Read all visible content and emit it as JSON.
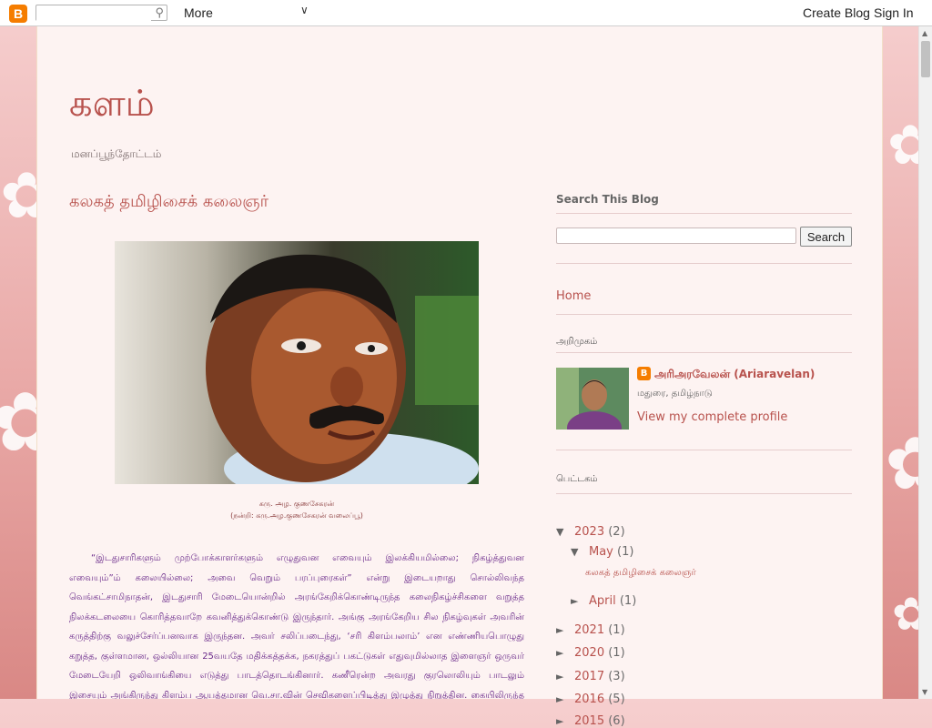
{
  "navbar": {
    "logo_glyph": "B",
    "search_placeholder": "",
    "more_label": "More",
    "create_blog": "Create Blog",
    "sign_in": "Sign In"
  },
  "blog": {
    "title": "களம்",
    "description": "மனப்பூந்தோட்டம்"
  },
  "post": {
    "title": "கலகத் தமிழிசைக் கலைஞர்",
    "caption_name": "கரு. அழ. குணசேகரன்",
    "caption_credit": "(நன்றி: கரு.அழ.குணசேகரன் வலைப்பூ)",
    "body": "“இடதுசாரிகளும் முற்போக்காளர்களும் எழுதுவன எவையும் இலக்கியமில்லை; நிகழ்த்துவன எவையும்”ம் கலையில்லை; அவை வெறும் பரப்புரைகள்” என்று இடையறாது சொல்லிவந்த வெங்கட்சாமிநாதன், இடதுசாரி மேடையொன்றில் அரங்கேறிக்கொண்டிருந்த கலைநிகழ்ச்சிகளை வறுத்த நிலக்கடலையை கொரித்தவாறே கவனித்துக்கொண்டு இருந்தார். அங்கு அரங்கேறிய சில நிகழ்வுகள் அவரின் கருத்திற்கு வலுச்சேர்ப்பனவாக இருந்தன. அவர் சலிப்படைந்து, ‘சரி கிளம்பலாம்’ என எண்ணியபொழுது கறுத்த, குள்ளமான, ஒல்லியான 25வயதே மதிக்கத்தக்க, நகரத்துப் பகட்டுகள் எதுவுமில்லாத இளைஞர் ஒருவர் மேடையேறி ஒலிவாங்கியை எடுத்து பாடத்தொடங்கினார். கணீரென்ற அவரது குரலொலியும் பாடலும் இசையும் அங்கிருந்து கிளம்ப ஆயத்தமான வெ.சா.வின் செவிகளைப்பிடித்து இழுத்து நிறுத்தின. கையிலிருந்த நிலக்கடலை தீர்ந்த பின்னரும் அவர் அங்கேயே"
  },
  "sidebar": {
    "search_title": "Search This Blog",
    "search_button": "Search",
    "home_link": "Home",
    "about_title": "அறிமுகம்",
    "profile_badge": "B",
    "profile_name": "அரிஅரவேலன் (Ariaravelan)",
    "profile_location": "மதுரை, தமிழ்நாடு",
    "profile_link": "View my complete profile",
    "archive_title": "பெட்டகம்",
    "archive": {
      "y2023": {
        "toggle": "▼",
        "year": "2023",
        "count": "(2)"
      },
      "may": {
        "toggle": "▼",
        "month": "May",
        "count": "(1)"
      },
      "may_post": "கலகத் தமிழிசைக் கலைஞர்",
      "april": {
        "toggle": "►",
        "month": "April",
        "count": "(1)"
      },
      "y2021": {
        "toggle": "►",
        "year": "2021",
        "count": "(1)"
      },
      "y2020": {
        "toggle": "►",
        "year": "2020",
        "count": "(1)"
      },
      "y2017": {
        "toggle": "►",
        "year": "2017",
        "count": "(3)"
      },
      "y2016": {
        "toggle": "►",
        "year": "2016",
        "count": "(5)"
      },
      "y2015": {
        "toggle": "►",
        "year": "2015",
        "count": "(6)"
      }
    }
  },
  "colors": {
    "accent": "#b8524d",
    "body_text": "#6a2a8a",
    "page_bg": "#fdf3f2",
    "blogger_orange": "#f57d00"
  }
}
